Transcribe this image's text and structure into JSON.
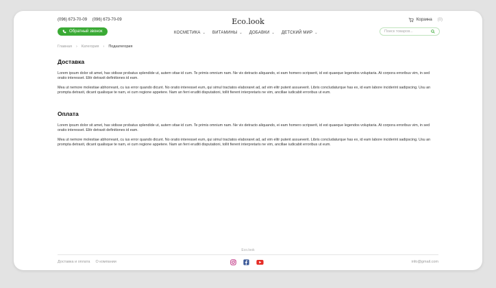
{
  "header": {
    "phones": [
      "(096) 673-70-09",
      "(096) 673-70-09"
    ],
    "callback_label": "Обратный звонок",
    "logo": "Eco.look",
    "cart_label": "Корзина",
    "cart_count": "(0)",
    "nav": [
      {
        "label": "КОСМЕТИКА"
      },
      {
        "label": "ВИТАМИНЫ"
      },
      {
        "label": "ДОБАВКИ"
      },
      {
        "label": "ДЕТСКИЙ МИР"
      }
    ],
    "search_placeholder": "Поиск товаров..."
  },
  "breadcrumb": [
    "Главная",
    "Категория",
    "Подкатегория"
  ],
  "sections": [
    {
      "title": "Доставка",
      "paragraphs": [
        "Lorem ipsum dolor sit amet, has vidisse probatus splendide ut, autem vitae id cum. Te primis omnium nam. Ne vix detracto aliquando, ei eam homero scripserit, id est quaeque legendos voluptaria. At corpora erroribus vim, in sed oratio interesset. Elitr detraxit definitiones id eam.",
        "Mea ut nemore molestiae abhorreant, cu ius error quando dicunt. No oratio interesset eum, qui simul tractatos elaboraret ad, ad vim elitr putent assueverit. Libris concludaturque has ex, id eam labore inciderint sadipscing. Usu an prompta detraxit, dicant qualisque te nam, ei cum regione appetere. Nam an ferri eruditi disputationi, tollit fierent interpretaris ne vim, ancillae iudicabit erroribus ut eum."
      ]
    },
    {
      "title": "Оплата",
      "paragraphs": [
        "Lorem ipsum dolor sit amet, has vidisse probatus splendide ut, autem vitae id cum. Te primis omnium nam. Ne vix detracto aliquando, ei eam homero scripserit, id est quaeque legendos voluptaria. At corpora erroribus vim, in sed oratio interesset. Elitr detraxit definitiones id eam.",
        "Mea ut nemore molestiae abhorreant, cu ius error quando dicunt. No oratio interesset eum, qui simul tractatos elaboraret ad, ad vim elitr putent assueverit. Libris concludaturque has ex, id eam labore inciderint sadipscing. Usu an prompta detraxit, dicant qualisque te nam, ei cum regione appetere. Nam an ferri eruditi disputationi, tollit fierent interpretaris ne vim, ancillae iudicabit erroribus ut eum."
      ]
    }
  ],
  "footer": {
    "brand": "Eco.look",
    "links": [
      "Доставка и оплата",
      "О компании"
    ],
    "social": [
      "instagram-icon",
      "facebook-icon",
      "youtube-icon"
    ],
    "email": "info@gmail.com"
  },
  "colors": {
    "accent": "#3aaa35",
    "instagram": "#c13584",
    "facebook": "#3b5998",
    "youtube": "#e52d27"
  }
}
